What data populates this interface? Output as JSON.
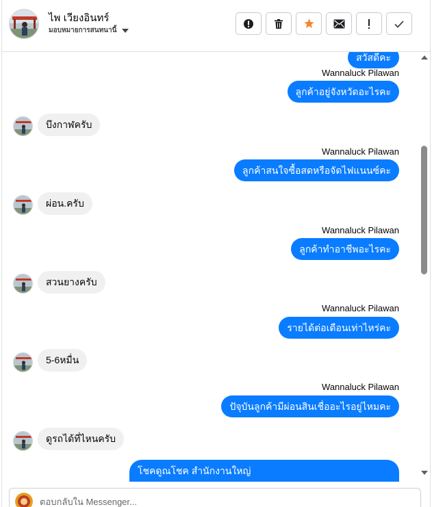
{
  "header": {
    "contact_name": "ไพ เวียงอินทร์",
    "contact_sub": "มอบหมายการสนทนานี้",
    "actions": [
      {
        "name": "report-spam-button",
        "icon": "alert-circle-icon"
      },
      {
        "name": "delete-button",
        "icon": "trash-icon"
      },
      {
        "name": "star-button",
        "icon": "star-icon",
        "color": "#f5862e"
      },
      {
        "name": "mark-unread-button",
        "icon": "envelope-icon"
      },
      {
        "name": "follow-up-button",
        "icon": "exclamation-icon"
      },
      {
        "name": "mark-done-button",
        "icon": "check-icon"
      }
    ]
  },
  "messages": {
    "m0": "สวัสดีคะ",
    "s1": "Wannaluck Pilawan",
    "m1": "ลูกค้าอยู่จังหวัดอะไรคะ",
    "r1": "บึงกาฬครับ",
    "s2": "Wannaluck Pilawan",
    "m2": "ลูกค้าสนใจซื้อสดหรือจัดไฟแนนซ์คะ",
    "r2": "ผ่อน.ครับ",
    "s3": "Wannaluck Pilawan",
    "m3": "ลูกค้าทำอาชีพอะไรคะ",
    "r3": "สวนยางครับ",
    "s4": "Wannaluck Pilawan",
    "m4": "รายได้ต่อเดือนเท่าไหร่คะ",
    "r4": "5-6หมื่น",
    "s5": "Wannaluck Pilawan",
    "m5": "ปัจุบันลูกค้ามีผ่อนสินเชื่ออะไรอยู่ไหมคะ",
    "r5": "ดูรถได้ที่ไหนครับ",
    "m6": "โชคดูณโชค สำนักงานใหญ่"
  },
  "composer": {
    "placeholder": "ตอบกลับใน Messenger..."
  },
  "colors": {
    "outgoing_bubble": "#0a7cff",
    "incoming_bubble": "#f0f0f0"
  }
}
